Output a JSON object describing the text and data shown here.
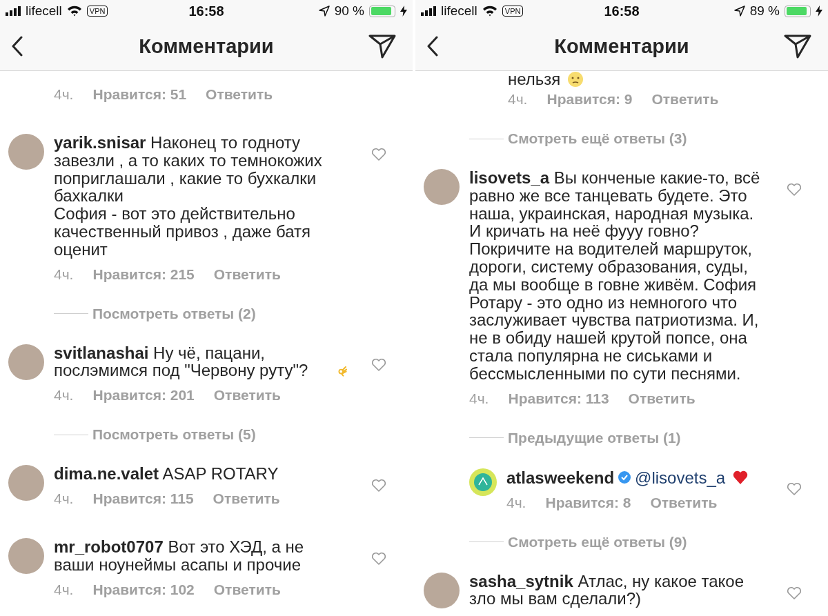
{
  "screens": [
    {
      "status_bar": {
        "carrier": "lifecell",
        "vpn": "VPN",
        "time": "16:58",
        "battery_text": "90 %",
        "battery": {
          "level": 0.9
        }
      },
      "header": {
        "title": "Комментарии"
      },
      "items": [
        {
          "kind": "meta",
          "is_reply": false,
          "time": "4ч.",
          "likes": "Нравится: 51",
          "reply": "Ответить"
        },
        {
          "kind": "comment",
          "is_reply": false,
          "avatar": {
            "kind": "photo"
          },
          "username": "yarik.snisar",
          "text": "Наконец то годноту завезли , а то каких то темнокожих поприглашали , какие то бухкалки бахкалки\nСофия - вот это действительно качественный привоз , даже батя оценит",
          "time": "4ч.",
          "likes": "Нравится: 215",
          "reply": "Ответить"
        },
        {
          "kind": "more",
          "label": "Посмотреть ответы (2)"
        },
        {
          "kind": "comment",
          "is_reply": false,
          "avatar": {
            "kind": "photo"
          },
          "username": "svitlanashai",
          "text": "Ну чё, пацани, послэмимся под \"Червону руту\"?",
          "emoji": {
            "kind": "ok-hand"
          },
          "time": "4ч.",
          "likes": "Нравится: 201",
          "reply": "Ответить"
        },
        {
          "kind": "more",
          "label": "Посмотреть ответы (5)"
        },
        {
          "kind": "comment",
          "is_reply": false,
          "avatar": {
            "kind": "photo"
          },
          "username": "dima.ne.valet",
          "text": "ASAP ROTARY",
          "time": "4ч.",
          "likes": "Нравится: 115",
          "reply": "Ответить"
        },
        {
          "kind": "comment",
          "is_reply": false,
          "avatar": {
            "kind": "photo"
          },
          "username": "mr_robot0707",
          "text": "Вот это ХЭД, а не ваши ноунеймы асапы и прочие",
          "time": "4ч.",
          "likes": "Нравится: 102",
          "reply": "Ответить"
        }
      ]
    },
    {
      "status_bar": {
        "carrier": "lifecell",
        "vpn": "VPN",
        "time": "16:58",
        "battery_text": "89 %",
        "battery": {
          "level": 0.89
        }
      },
      "header": {
        "title": "Комментарии"
      },
      "items": [
        {
          "kind": "tail",
          "is_reply": true,
          "text": "нельзя",
          "emoji": {
            "kind": "face"
          },
          "time": "4ч.",
          "likes": "Нравится: 9",
          "reply": "Ответить"
        },
        {
          "kind": "more",
          "label": "Смотреть ещё ответы (3)"
        },
        {
          "kind": "comment",
          "is_reply": false,
          "avatar": {
            "kind": "photo"
          },
          "username": "lisovets_a",
          "text": "Вы конченые какие-то, всё равно же все танцевать будете. Это наша, украинская, народная музыка. И кричать на неё фууу говно? Покричите на водителей маршруток, дороги, систему образования, суды, да мы вообще в говне живём. София Ротару - это одно из немногого что заслуживает чувства патриотизма. И, не в обиду нашей крутой попсе, она стала популярна не сиськами и бессмысленными по сути песнями.",
          "time": "4ч.",
          "likes": "Нравится: 113",
          "reply": "Ответить"
        },
        {
          "kind": "more",
          "label": "Предыдущие ответы (1)"
        },
        {
          "kind": "comment",
          "is_reply": true,
          "avatar": {
            "kind": "logo"
          },
          "username": "atlasweekend",
          "verified": true,
          "mention": "@lisovets_a",
          "emoji": {
            "kind": "red-heart"
          },
          "time": "4ч.",
          "likes": "Нравится: 8",
          "reply": "Ответить"
        },
        {
          "kind": "more",
          "label": "Смотреть ещё ответы (9)"
        },
        {
          "kind": "comment",
          "is_reply": false,
          "avatar": {
            "kind": "photo"
          },
          "username": "sasha_sytnik",
          "text": "Атлас, ну какое такое зло мы вам сделали?)"
        }
      ]
    }
  ]
}
